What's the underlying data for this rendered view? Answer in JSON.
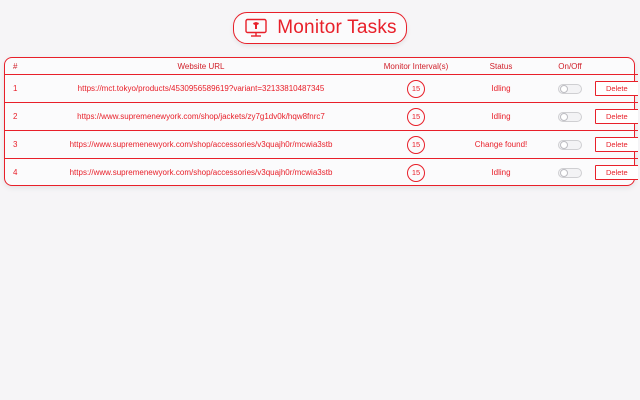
{
  "header": {
    "title": "Monitor Tasks",
    "icon": "monitor-icon"
  },
  "colors": {
    "accent": "#e8202a",
    "background": "#f6f5f7",
    "toggle_off": "#f3f3f5"
  },
  "table": {
    "columns": {
      "num": "#",
      "url": "Website URL",
      "interval": "Monitor Interval(s)",
      "status": "Status",
      "onoff": "On/Off"
    },
    "rows": [
      {
        "num": "1",
        "url": "https://mct.tokyo/products/4530956589619?variant=32133810487345",
        "interval": "15",
        "status": "Idling",
        "enabled": false,
        "delete_label": "Delete"
      },
      {
        "num": "2",
        "url": "https://www.supremenewyork.com/shop/jackets/zy7g1dv0k/hqw8fnrc7",
        "interval": "15",
        "status": "Idling",
        "enabled": false,
        "delete_label": "Delete"
      },
      {
        "num": "3",
        "url": "https://www.supremenewyork.com/shop/accessories/v3quajh0r/mcwia3stb",
        "interval": "15",
        "status": "Change found!",
        "enabled": false,
        "delete_label": "Delete"
      },
      {
        "num": "4",
        "url": "https://www.supremenewyork.com/shop/accessories/v3quajh0r/mcwia3stb",
        "interval": "15",
        "status": "Idling",
        "enabled": false,
        "delete_label": "Delete"
      }
    ]
  }
}
